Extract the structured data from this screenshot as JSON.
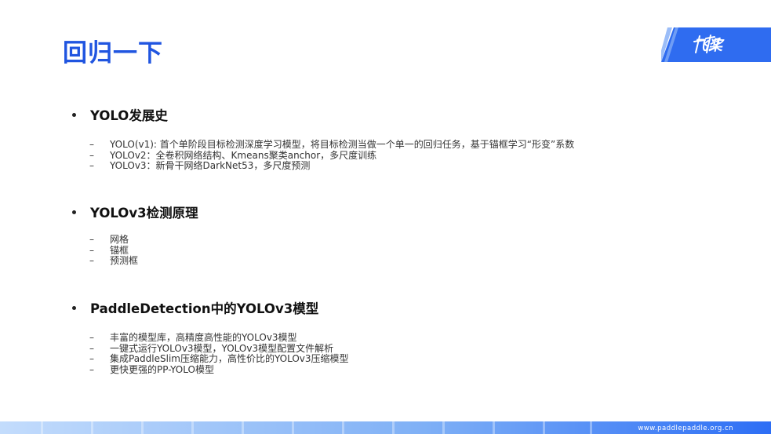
{
  "title": "回归一下",
  "logo": {
    "text": "飞桨",
    "mark": "paddle-logo-icon"
  },
  "sections": [
    {
      "heading": "YOLO发展史",
      "items": [
        "YOLO(v1): 首个单阶段目标检测深度学习模型，将目标检测当做一个单一的回归任务，基于锚框学习“形变”系数",
        "YOLOv2：全卷积网络结构、Kmeans聚类anchor，多尺度训练",
        "YOLOv3：新骨干网络DarkNet53，多尺度预测"
      ]
    },
    {
      "heading": "YOLOv3检测原理",
      "items": [
        "网格",
        "锚框",
        "预测框"
      ]
    },
    {
      "heading": "PaddleDetection中的YOLOv3模型",
      "items": [
        "丰富的模型库，高精度高性能的YOLOv3模型",
        "一键式运行YOLOv3模型，YOLOv3模型配置文件解析",
        "集成PaddleSlim压缩能力，高性价比的YOLOv3压缩模型",
        "更快更强的PP-YOLO模型"
      ]
    }
  ],
  "footer": {
    "url": "www.paddlepaddle.org.cn"
  },
  "colors": {
    "accent": "#2055e0",
    "logo_bg": "#2f6cf0",
    "footer_light": "#b9d4fb",
    "footer_dark": "#2d6ef5"
  }
}
